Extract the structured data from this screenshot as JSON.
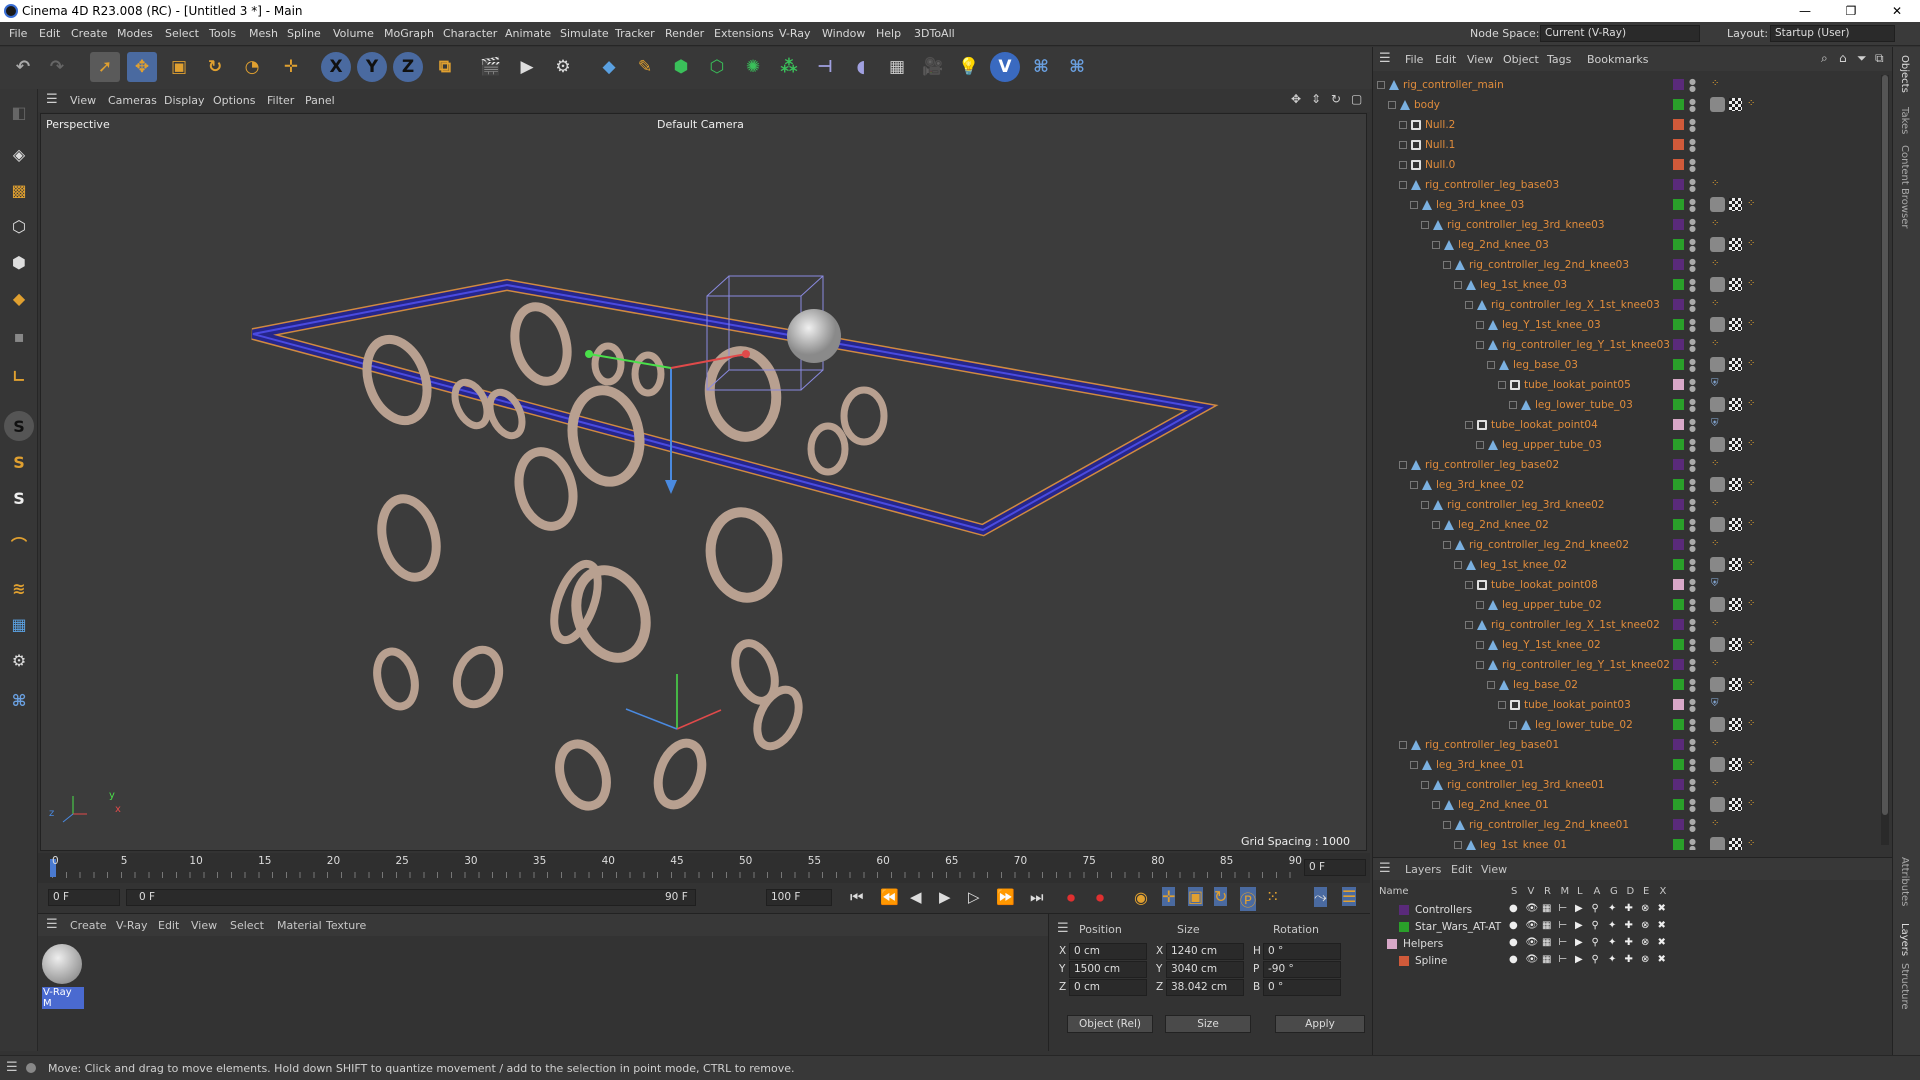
{
  "window": {
    "title": "Cinema 4D R23.008 (RC) - [Untitled 3 *] - Main",
    "min": "—",
    "max": "❐",
    "close": "✕"
  },
  "menu": [
    "File",
    "Edit",
    "Create",
    "Modes",
    "Select",
    "Tools",
    "Mesh",
    "Spline",
    "Volume",
    "MoGraph",
    "Character",
    "Animate",
    "Simulate",
    "Tracker",
    "Render",
    "Extensions",
    "V-Ray",
    "Window",
    "Help",
    "3DToAll"
  ],
  "nodespace": {
    "label": "Node Space:",
    "value": "Current (V-Ray)"
  },
  "layout": {
    "label": "Layout:",
    "value": "Startup (User)"
  },
  "toolbar": {
    "x": "X",
    "y": "Y",
    "z": "Z"
  },
  "viewport_menu": [
    "View",
    "Cameras",
    "Display",
    "Options",
    "Filter",
    "Panel"
  ],
  "viewport": {
    "name": "Perspective",
    "camera": "Default Camera",
    "grid": "Grid Spacing : 1000 cm",
    "axis_x": "x",
    "axis_y": "y",
    "axis_z": "z"
  },
  "timeline": {
    "ticks": [
      "0",
      "5",
      "10",
      "15",
      "20",
      "25",
      "30",
      "35",
      "40",
      "45",
      "50",
      "55",
      "60",
      "65",
      "70",
      "75",
      "80",
      "85",
      "90"
    ],
    "current": "0 F"
  },
  "timectrl": {
    "start": "0 F",
    "range_start": "0 F",
    "range_end": "90 F",
    "end": "100 F"
  },
  "material_menu": [
    "Create",
    "V-Ray",
    "Edit",
    "View",
    "Select",
    "Material",
    "Texture"
  ],
  "material": {
    "name": "V-Ray M"
  },
  "coords": {
    "headers": [
      "Position",
      "Size",
      "Rotation"
    ],
    "rows": [
      {
        "axis": "X",
        "pos": "0 cm",
        "saxis": "X",
        "size": "1240 cm",
        "raxis": "H",
        "rot": "0 °"
      },
      {
        "axis": "Y",
        "pos": "1500 cm",
        "saxis": "Y",
        "size": "3040 cm",
        "raxis": "P",
        "rot": "-90 °"
      },
      {
        "axis": "Z",
        "pos": "0 cm",
        "saxis": "Z",
        "size": "38.042 cm",
        "raxis": "B",
        "rot": "0 °"
      }
    ],
    "mode": "Object (Rel)",
    "size_mode": "Size",
    "apply": "Apply"
  },
  "status": "Move: Click and drag to move elements. Hold down SHIFT to quantize movement / add to the selection in point mode, CTRL to remove.",
  "objects_menu": [
    "File",
    "Edit",
    "View",
    "Object",
    "Tags",
    "Bookmarks"
  ],
  "objects": [
    {
      "name": "rig_controller_main",
      "depth": 0,
      "icon": "joint",
      "layer": "#5a2a7a",
      "t": 1
    },
    {
      "name": "body",
      "depth": 1,
      "icon": "joint",
      "layer": "#2aa02a",
      "t": 3
    },
    {
      "name": "Null.2",
      "depth": 2,
      "icon": "null",
      "layer": "#d05a3a",
      "t": 0
    },
    {
      "name": "Null.1",
      "depth": 2,
      "icon": "null",
      "layer": "#d05a3a",
      "t": 0
    },
    {
      "name": "Null.0",
      "depth": 2,
      "icon": "null",
      "layer": "#d05a3a",
      "t": 0
    },
    {
      "name": "rig_controller_leg_base03",
      "depth": 2,
      "icon": "joint",
      "layer": "#5a2a7a",
      "t": 1
    },
    {
      "name": "leg_3rd_knee_03",
      "depth": 3,
      "icon": "joint",
      "layer": "#2aa02a",
      "t": 3
    },
    {
      "name": "rig_controller_leg_3rd_knee03",
      "depth": 4,
      "icon": "joint",
      "layer": "#5a2a7a",
      "t": 1
    },
    {
      "name": "leg_2nd_knee_03",
      "depth": 5,
      "icon": "joint",
      "layer": "#2aa02a",
      "t": 3
    },
    {
      "name": "rig_controller_leg_2nd_knee03",
      "depth": 6,
      "icon": "joint",
      "layer": "#5a2a7a",
      "t": 1
    },
    {
      "name": "leg_1st_knee_03",
      "depth": 7,
      "icon": "joint",
      "layer": "#2aa02a",
      "t": 3
    },
    {
      "name": "rig_controller_leg_X_1st_knee03",
      "depth": 8,
      "icon": "joint",
      "layer": "#5a2a7a",
      "t": 1
    },
    {
      "name": "leg_Y_1st_knee_03",
      "depth": 9,
      "icon": "joint",
      "layer": "#2aa02a",
      "t": 3
    },
    {
      "name": "rig_controller_leg_Y_1st_knee03",
      "depth": 9,
      "icon": "joint",
      "layer": "#5a2a7a",
      "t": 1
    },
    {
      "name": "leg_base_03",
      "depth": 10,
      "icon": "joint",
      "layer": "#2aa02a",
      "t": 3
    },
    {
      "name": "tube_lookat_point05",
      "depth": 11,
      "icon": "null",
      "layer": "#d8a8c8",
      "t": 2
    },
    {
      "name": "leg_lower_tube_03",
      "depth": 12,
      "icon": "joint",
      "layer": "#2aa02a",
      "t": 3
    },
    {
      "name": "tube_lookat_point04",
      "depth": 8,
      "icon": "null",
      "layer": "#d8a8c8",
      "t": 2
    },
    {
      "name": "leg_upper_tube_03",
      "depth": 9,
      "icon": "joint",
      "layer": "#2aa02a",
      "t": 3
    },
    {
      "name": "rig_controller_leg_base02",
      "depth": 2,
      "icon": "joint",
      "layer": "#5a2a7a",
      "t": 1
    },
    {
      "name": "leg_3rd_knee_02",
      "depth": 3,
      "icon": "joint",
      "layer": "#2aa02a",
      "t": 3
    },
    {
      "name": "rig_controller_leg_3rd_knee02",
      "depth": 4,
      "icon": "joint",
      "layer": "#5a2a7a",
      "t": 1
    },
    {
      "name": "leg_2nd_knee_02",
      "depth": 5,
      "icon": "joint",
      "layer": "#2aa02a",
      "t": 3
    },
    {
      "name": "rig_controller_leg_2nd_knee02",
      "depth": 6,
      "icon": "joint",
      "layer": "#5a2a7a",
      "t": 1
    },
    {
      "name": "leg_1st_knee_02",
      "depth": 7,
      "icon": "joint",
      "layer": "#2aa02a",
      "t": 3
    },
    {
      "name": "tube_lookat_point08",
      "depth": 8,
      "icon": "null",
      "layer": "#d8a8c8",
      "t": 2
    },
    {
      "name": "leg_upper_tube_02",
      "depth": 9,
      "icon": "joint",
      "layer": "#2aa02a",
      "t": 3
    },
    {
      "name": "rig_controller_leg_X_1st_knee02",
      "depth": 8,
      "icon": "joint",
      "layer": "#5a2a7a",
      "t": 1
    },
    {
      "name": "leg_Y_1st_knee_02",
      "depth": 9,
      "icon": "joint",
      "layer": "#2aa02a",
      "t": 3
    },
    {
      "name": "rig_controller_leg_Y_1st_knee02",
      "depth": 9,
      "icon": "joint",
      "layer": "#5a2a7a",
      "t": 1
    },
    {
      "name": "leg_base_02",
      "depth": 10,
      "icon": "joint",
      "layer": "#2aa02a",
      "t": 3
    },
    {
      "name": "tube_lookat_point03",
      "depth": 11,
      "icon": "null",
      "layer": "#d8a8c8",
      "t": 2
    },
    {
      "name": "leg_lower_tube_02",
      "depth": 12,
      "icon": "joint",
      "layer": "#2aa02a",
      "t": 3
    },
    {
      "name": "rig_controller_leg_base01",
      "depth": 2,
      "icon": "joint",
      "layer": "#5a2a7a",
      "t": 1
    },
    {
      "name": "leg_3rd_knee_01",
      "depth": 3,
      "icon": "joint",
      "layer": "#2aa02a",
      "t": 3
    },
    {
      "name": "rig_controller_leg_3rd_knee01",
      "depth": 4,
      "icon": "joint",
      "layer": "#5a2a7a",
      "t": 1
    },
    {
      "name": "leg_2nd_knee_01",
      "depth": 5,
      "icon": "joint",
      "layer": "#2aa02a",
      "t": 3
    },
    {
      "name": "rig_controller_leg_2nd_knee01",
      "depth": 6,
      "icon": "joint",
      "layer": "#5a2a7a",
      "t": 1
    },
    {
      "name": "leg_1st_knee_01",
      "depth": 7,
      "icon": "joint",
      "layer": "#2aa02a",
      "t": 3
    }
  ],
  "layers_menu": [
    "Layers",
    "Edit",
    "View"
  ],
  "layers_header": {
    "name": "Name",
    "cols": [
      "S",
      "V",
      "R",
      "M",
      "L",
      "A",
      "G",
      "D",
      "E",
      "X"
    ]
  },
  "layers": [
    {
      "name": "Controllers",
      "color": "#5a2a7a",
      "depth": 1
    },
    {
      "name": "Star_Wars_AT-AT",
      "color": "#2aa02a",
      "depth": 1
    },
    {
      "name": "Helpers",
      "color": "#d8a8c8",
      "depth": 0
    },
    {
      "name": "Spline",
      "color": "#d05a3a",
      "depth": 1
    }
  ],
  "right_tabs": [
    "Objects",
    "Takes",
    "Content Browser",
    "Attributes",
    "Layers",
    "Structure"
  ]
}
